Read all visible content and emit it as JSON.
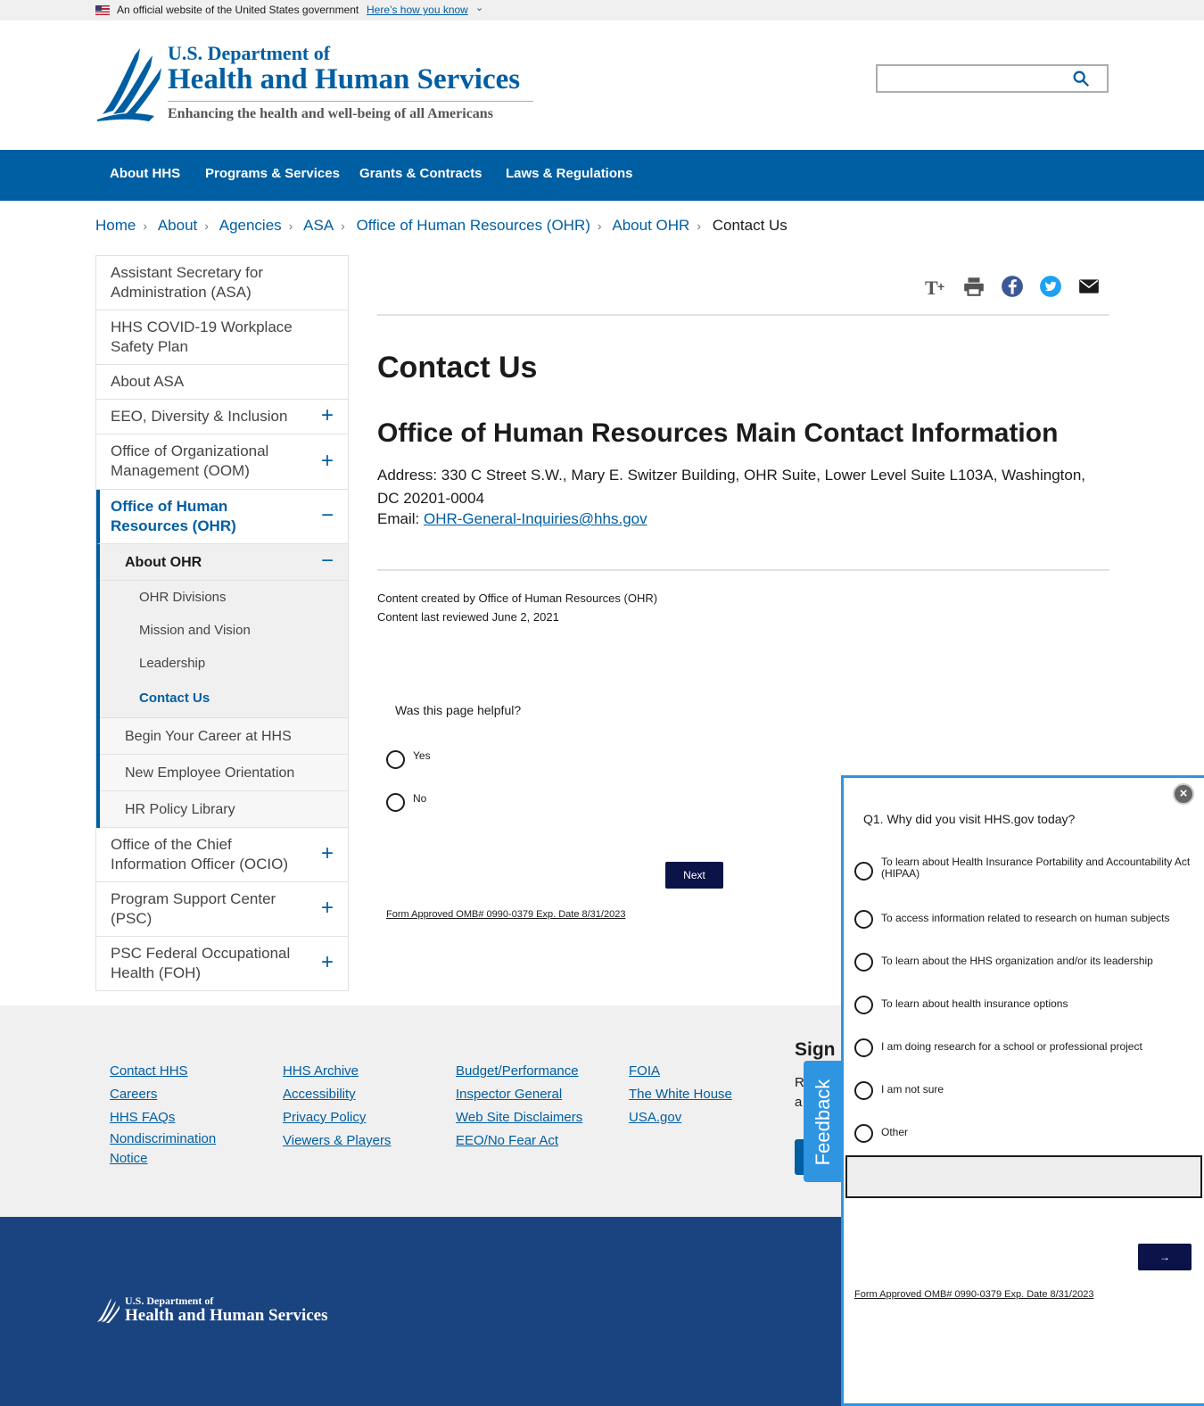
{
  "gov_banner": {
    "text": "An official website of the United States government",
    "how_link": "Here’s how you know"
  },
  "header": {
    "logo_line1": "U.S. Department of",
    "logo_line2": "Health and Human Services",
    "tagline": "Enhancing the health and well-being of all Americans",
    "search_placeholder": ""
  },
  "nav": {
    "items": [
      "About HHS",
      "Programs & Services",
      "Grants & Contracts",
      "Laws & Regulations"
    ]
  },
  "breadcrumb": {
    "items": [
      "Home",
      "About",
      "Agencies",
      "ASA",
      "Office of Human Resources (OHR)",
      "About OHR"
    ],
    "current": "Contact Us"
  },
  "sidenav": {
    "items": [
      "Assistant Secretary for Administration (ASA)",
      "HHS COVID-19 Workplace Safety Plan",
      "About ASA",
      "EEO, Diversity & Inclusion",
      "Office of Organizational Management (OOM)",
      "Office of Human Resources (OHR)",
      "About OHR",
      "OHR Divisions",
      "Mission and Vision",
      "Leadership",
      "Contact Us",
      "Begin Your Career at HHS",
      "New Employee Orientation",
      "HR Policy Library",
      "Office of the Chief Information Officer (OCIO)",
      "Program Support Center (PSC)",
      "PSC Federal Occupational Health (FOH)"
    ]
  },
  "main": {
    "title": "Contact Us",
    "section_title": "Office of Human Resources Main Contact Information",
    "address": "Address: 330 C Street S.W., Mary E. Switzer Building, OHR Suite, Lower Level Suite L103A, Washington, DC 20201-0004",
    "email_label": "Email: ",
    "email_link": "OHR-General-Inquiries@hhs.gov",
    "created_by": "Content created by Office of Human Resources (OHR)",
    "last_reviewed": "Content last reviewed June 2, 2021"
  },
  "survey": {
    "question": "Was this page helpful?",
    "yes": "Yes",
    "no": "No",
    "next": "Next",
    "form_note": "Form Approved OMB# 0990-0379 Exp. Date 8/31/2023"
  },
  "footer": {
    "col1": [
      "Contact HHS",
      "Careers",
      "HHS FAQs",
      "Nondiscrimination Notice"
    ],
    "col2": [
      "HHS Archive",
      "Accessibility",
      "Privacy Policy",
      "Viewers & Players"
    ],
    "col3": [
      "Budget/Performance",
      "Inspector General",
      "Web Site Disclaimers",
      "EEO/No Fear Act"
    ],
    "col4": [
      "FOIA",
      "The White House",
      "USA.gov"
    ],
    "signup_title": "Sign U",
    "signup_text_1": "R",
    "signup_text_2": "a",
    "logo_line1": "U.S. Department of",
    "logo_line2": "Health and Human Services"
  },
  "feedback": {
    "tab_label": "Feedback",
    "close": "×",
    "question": "Q1. Why did you visit HHS.gov today?",
    "options": [
      "To learn about Health Insurance Portability and Accountability Act (HIPAA)",
      "To access information related to research on human subjects",
      "To learn about the HHS organization and/or its leadership",
      "To learn about health insurance options",
      "I am doing research for a school or professional project",
      "I am not sure",
      "Other"
    ],
    "next": "→",
    "form_note": "Form Approved OMB# 0990-0379 Exp. Date 8/31/2023"
  },
  "colors": {
    "primary": "#005ea2",
    "footer_dark": "#1a4480",
    "feedback_blue": "#2f95e0",
    "button_navy": "#0b1348"
  }
}
